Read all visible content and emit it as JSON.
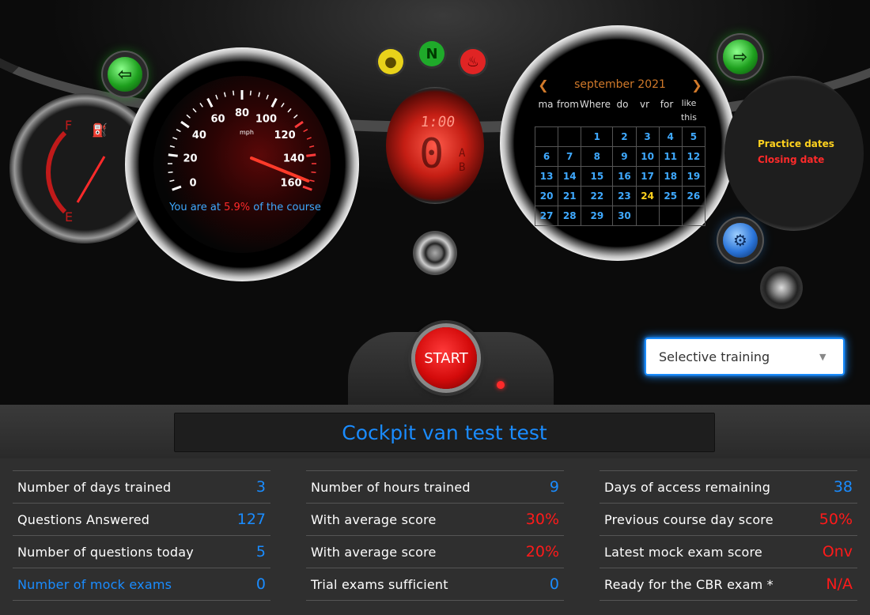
{
  "speedometer": {
    "message_prefix": "You are at",
    "percent": "5.9%",
    "message_suffix": "of the course",
    "progress_value": 5.9,
    "tick_labels": [
      "0",
      "20",
      "40",
      "60",
      "80",
      "100",
      "120",
      "140",
      "160"
    ],
    "unit": "mph"
  },
  "indicators": {
    "neutral_label": "N"
  },
  "calendar": {
    "month_label": "september 2021",
    "weekdays": [
      "ma",
      "from",
      "Where",
      "do",
      "vr",
      "for",
      "like this"
    ],
    "weeks": [
      [
        "",
        "",
        "1",
        "2",
        "3",
        "4",
        "5"
      ],
      [
        "6",
        "7",
        "8",
        "9",
        "10",
        "11",
        "12"
      ],
      [
        "13",
        "14",
        "15",
        "16",
        "17",
        "18",
        "19"
      ],
      [
        "20",
        "21",
        "22",
        "23",
        "24",
        "25",
        "26"
      ],
      [
        "27",
        "28",
        "29",
        "30",
        "",
        "",
        ""
      ]
    ],
    "highlighted_day": "24"
  },
  "legend": {
    "practice": "Practice dates",
    "closing": "Closing date"
  },
  "start_button": {
    "label": "START"
  },
  "training_select": {
    "value": "Selective training"
  },
  "page_title": "Cockpit van test test",
  "stats": {
    "col1": [
      {
        "label": "Number of days trained",
        "value": "3",
        "red": false,
        "link": false
      },
      {
        "label": "Questions Answered",
        "value": "127",
        "red": false,
        "link": false
      },
      {
        "label": "Number of questions today",
        "value": "5",
        "red": false,
        "link": false
      },
      {
        "label": "Number of mock exams",
        "value": "0",
        "red": false,
        "link": true
      }
    ],
    "col2": [
      {
        "label": "Number of hours trained",
        "value": "9",
        "red": false,
        "link": false
      },
      {
        "label": "With average score",
        "value": "30%",
        "red": true,
        "link": false
      },
      {
        "label": "With average score",
        "value": "20%",
        "red": true,
        "link": false
      },
      {
        "label": "Trial exams sufficient",
        "value": "0",
        "red": false,
        "link": false
      }
    ],
    "col3": [
      {
        "label": "Days of access remaining",
        "value": "38",
        "red": false,
        "link": false
      },
      {
        "label": "Previous course day score",
        "value": "50%",
        "red": true,
        "link": false
      },
      {
        "label": "Latest mock exam score",
        "value": "Onv",
        "red": true,
        "link": false
      },
      {
        "label": "Ready for the CBR exam *",
        "value": "N/A",
        "red": true,
        "link": false
      }
    ]
  }
}
